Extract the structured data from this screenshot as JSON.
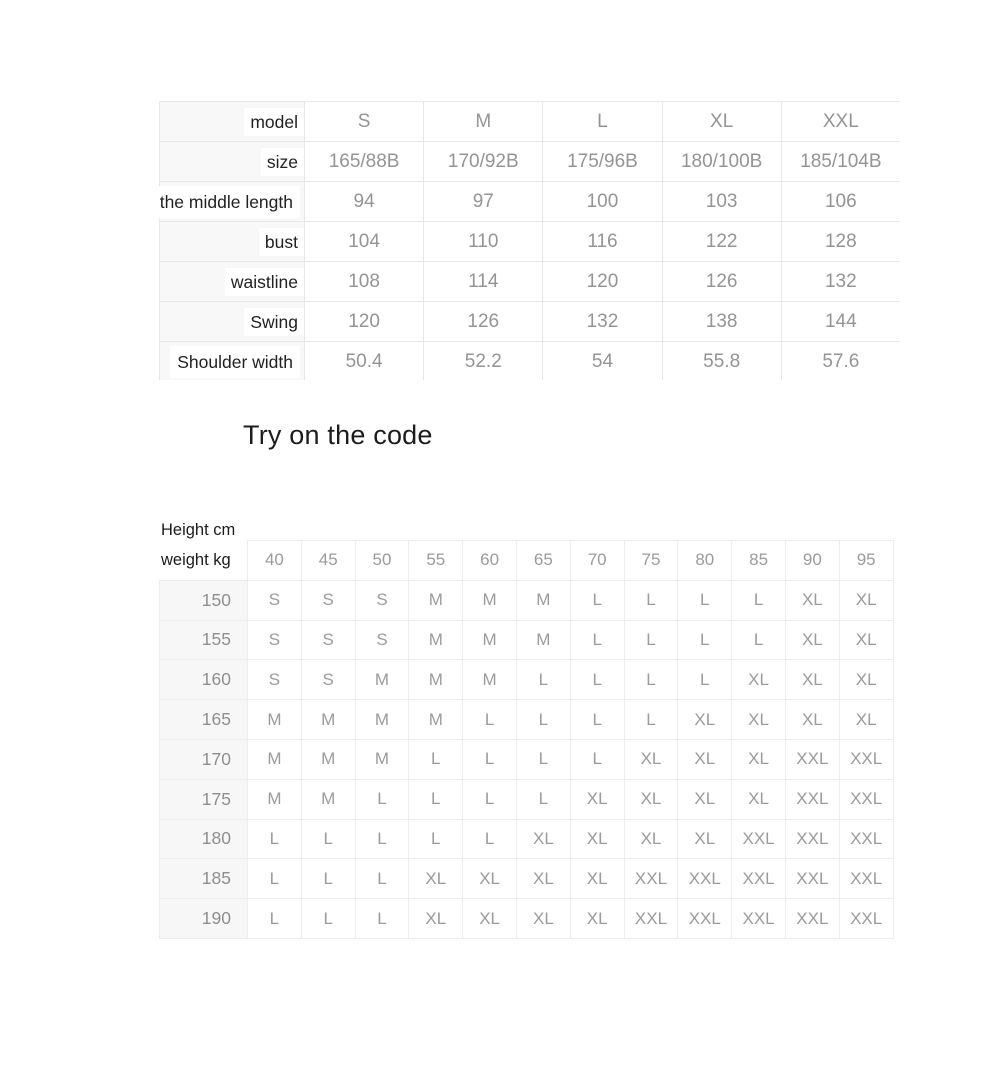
{
  "spec_table": {
    "name": "garment-measurement-table",
    "row_labels": [
      "model",
      "size",
      "After the middle length",
      "bust",
      "waistline",
      "Swing",
      "Shoulder width"
    ],
    "rows": [
      {
        "label": "model",
        "values": [
          "S",
          "M",
          "L",
          "XL",
          "XXL"
        ]
      },
      {
        "label": "size",
        "values": [
          "165/88B",
          "170/92B",
          "175/96B",
          "180/100B",
          "185/104B"
        ]
      },
      {
        "label": "After the middle length",
        "values": [
          "94",
          "97",
          "100",
          "103",
          "106"
        ]
      },
      {
        "label": "bust",
        "values": [
          "104",
          "110",
          "116",
          "122",
          "128"
        ]
      },
      {
        "label": "waistline",
        "values": [
          "108",
          "114",
          "120",
          "126",
          "132"
        ]
      },
      {
        "label": "Swing",
        "values": [
          "120",
          "126",
          "132",
          "138",
          "144"
        ]
      },
      {
        "label": "Shoulder width",
        "values": [
          "50.4",
          "52.2",
          "54",
          "55.8",
          "57.6"
        ]
      }
    ]
  },
  "heading": {
    "try_on_the_code": "Try on the code"
  },
  "fit_table": {
    "name": "height-weight-size-matrix",
    "corner_top_label": "Height cm",
    "corner_bottom_label": "weight kg",
    "weight_columns": [
      "40",
      "45",
      "50",
      "55",
      "60",
      "65",
      "70",
      "75",
      "80",
      "85",
      "90",
      "95"
    ],
    "heights": [
      "150",
      "155",
      "160",
      "165",
      "170",
      "175",
      "180",
      "185",
      "190"
    ],
    "rows": [
      {
        "height": "150",
        "sizes": [
          "S",
          "S",
          "S",
          "M",
          "M",
          "M",
          "L",
          "L",
          "L",
          "L",
          "XL",
          "XL"
        ]
      },
      {
        "height": "155",
        "sizes": [
          "S",
          "S",
          "S",
          "M",
          "M",
          "M",
          "L",
          "L",
          "L",
          "L",
          "XL",
          "XL"
        ]
      },
      {
        "height": "160",
        "sizes": [
          "S",
          "S",
          "M",
          "M",
          "M",
          "L",
          "L",
          "L",
          "L",
          "XL",
          "XL",
          "XL"
        ]
      },
      {
        "height": "165",
        "sizes": [
          "M",
          "M",
          "M",
          "M",
          "L",
          "L",
          "L",
          "L",
          "XL",
          "XL",
          "XL",
          "XL"
        ]
      },
      {
        "height": "170",
        "sizes": [
          "M",
          "M",
          "M",
          "L",
          "L",
          "L",
          "L",
          "XL",
          "XL",
          "XL",
          "XXL",
          "XXL"
        ]
      },
      {
        "height": "175",
        "sizes": [
          "M",
          "M",
          "L",
          "L",
          "L",
          "L",
          "XL",
          "XL",
          "XL",
          "XL",
          "XXL",
          "XXL"
        ]
      },
      {
        "height": "180",
        "sizes": [
          "L",
          "L",
          "L",
          "L",
          "L",
          "XL",
          "XL",
          "XL",
          "XL",
          "XXL",
          "XXL",
          "XXL"
        ]
      },
      {
        "height": "185",
        "sizes": [
          "L",
          "L",
          "L",
          "XL",
          "XL",
          "XL",
          "XL",
          "XXL",
          "XXL",
          "XXL",
          "XXL",
          "XXL"
        ]
      },
      {
        "height": "190",
        "sizes": [
          "L",
          "L",
          "L",
          "XL",
          "XL",
          "XL",
          "XL",
          "XXL",
          "XXL",
          "XXL",
          "XXL",
          "XXL"
        ]
      }
    ]
  },
  "colors": {
    "page_background": "#ffffff",
    "cell_border": "#e8e8e8",
    "label_column_background": "#f8f8f8",
    "value_text": "#949494",
    "label_text": "#222222",
    "heading_text": "#1c1c1c"
  }
}
